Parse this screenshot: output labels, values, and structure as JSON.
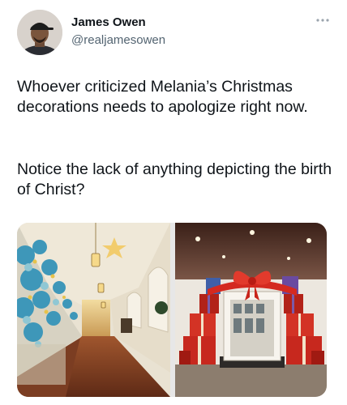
{
  "author": {
    "display_name": "James Owen",
    "handle": "@realjamesowen",
    "avatar_icon": "user-avatar"
  },
  "more_icon": "ellipsis-icon",
  "tweet": {
    "paragraphs": [
      "Whoever criticized Melania’s Christmas decorations needs to apologize right now.",
      "Notice the lack of anything depicting the birth of Christ?"
    ]
  },
  "media": [
    {
      "name": "hallway-decorations-photo"
    },
    {
      "name": "gift-box-doorway-photo"
    }
  ]
}
